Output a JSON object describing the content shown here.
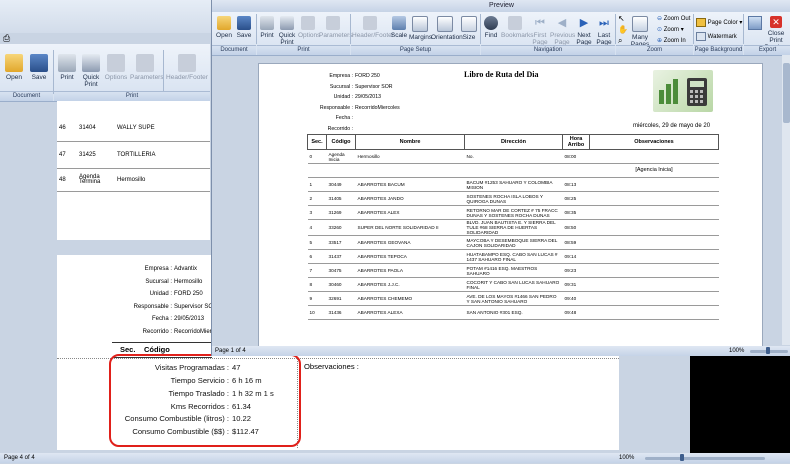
{
  "back_window": {
    "ribbon": {
      "buttons": {
        "open": "Open",
        "save": "Save",
        "print": "Print",
        "quick_print": "Quick Print",
        "options": "Options",
        "parameters": "Parameters",
        "header_footer": "Header/Footer"
      },
      "groups": {
        "document": "Document",
        "print": "Print"
      }
    },
    "upper_rows": [
      {
        "num": "46",
        "code": "31404",
        "name": "WALLY SUPE"
      },
      {
        "num": "47",
        "code": "31425",
        "name": "TORTILLERIA"
      },
      {
        "num": "48",
        "code": "Agenda Termina",
        "name": "Hermosillo"
      }
    ],
    "header": {
      "labels": {
        "empresa": "Empresa :",
        "sucursal": "Sucursal :",
        "unidad": "Unidad :",
        "responsable": "Responsable :",
        "fecha": "Fecha :",
        "recorrido": "Recorrido :"
      },
      "values": {
        "empresa": "Advantix",
        "sucursal": "Hermosillo",
        "unidad": "FORD 250",
        "responsable": "Supervisor SOR",
        "fecha": "29/05/2013",
        "recorrido": "RecorridoMiercol"
      }
    },
    "columns": {
      "sec": "Sec.",
      "codigo": "Código"
    },
    "summary": {
      "visitas_label": "Visitas Programadas :",
      "visitas_value": "47",
      "tiempo_servicio_label": "Tiempo Servicio :",
      "tiempo_servicio_value": "6 h 16 m",
      "tiempo_traslado_label": "Tiempo Traslado :",
      "tiempo_traslado_value": "1 h 32 m 1 s",
      "kms_label": "Kms Recorridos :",
      "kms_value": "61.34",
      "consumo_litros_label": "Consumo Combustible (litros) :",
      "consumo_litros_value": "10.22",
      "consumo_pesos_label": "Consumo Combustible ($$) :",
      "consumo_pesos_value": "$112.47",
      "observaciones_label": "Observaciones :"
    },
    "status": {
      "page": "Page 4 of 4",
      "zoom": "100%"
    },
    "highlight_color": "#e0201a"
  },
  "preview_window": {
    "title": "Preview",
    "ribbon": {
      "buttons": {
        "open": "Open",
        "save": "Save",
        "print": "Print",
        "quick_print": "Quick Print",
        "options": "Options",
        "parameters": "Parameters",
        "header_footer": "Header/Footer",
        "scale": "Scale",
        "margins": "Margins",
        "orientation": "Orientation",
        "size": "Size",
        "find": "Find",
        "bookmarks": "Bookmarks",
        "first_page": "First Page",
        "previous_page": "Previous Page",
        "next_page": "Next Page",
        "last_page": "Last Page",
        "many_pages": "Many Pages",
        "zoom_out": "Zoom Out",
        "zoom": "Zoom",
        "zoom_in": "Zoom In",
        "page_color": "Page Color",
        "watermark": "Watermark",
        "close": "Close Print Preview"
      },
      "groups": {
        "document": "Document",
        "print": "Print",
        "page_setup": "Page Setup",
        "navigation": "Navigation",
        "zoom": "Zoom",
        "page_background": "Page Background",
        "export": "Export"
      }
    },
    "report": {
      "title": "Libro de Ruta del Dia",
      "labels": {
        "empresa": "Empresa :",
        "sucursal": "Sucursal :",
        "unidad": "Unidad :",
        "responsable": "Responsable :",
        "fecha": "Fecha :",
        "recorrido": "Recorrido :"
      },
      "values": {
        "empresa": "",
        "sucursal": "",
        "unidad": "FORD 250",
        "responsable": "Supervisor SOR",
        "fecha": "29/05/2013",
        "recorrido": "RecorridoMiercoles"
      },
      "date_long": "miércoles, 29 de mayo de 20",
      "columns": {
        "sec": "Sec.",
        "codigo": "Código",
        "nombre": "Nombre",
        "direccion": "Dirección",
        "hora": "Hora Arribo",
        "observaciones": "Observaciones"
      },
      "rows": [
        {
          "sec": "0",
          "codigo": "Agenda Inicia",
          "nombre": "Hermosillo",
          "direccion": "No.",
          "hora": "08:00",
          "obs": ""
        },
        {
          "sec": "",
          "codigo": "",
          "nombre": "",
          "direccion": "",
          "hora": "",
          "obs": "[Agencia Inicia]"
        },
        {
          "sec": "1",
          "codigo": "30449",
          "nombre": "ABARROTES BACUM",
          "direccion": "BACUM #1253 SAHUARO Y COLOMBIA MISION",
          "hora": "08:13",
          "obs": ""
        },
        {
          "sec": "2",
          "codigo": "31405",
          "nombre": "ABARROTES JANDO",
          "direccion": "SOSTENES ROCHA ISLA LOBOS Y QUIROGA DUNAS",
          "hora": "08:25",
          "obs": ""
        },
        {
          "sec": "3",
          "codigo": "31269",
          "nombre": "ABARROTES ALEX",
          "direccion": "RETORNO MAR DE CORTEZ # 75 FRACC DUNAS Y SOSTENES ROCHA DUNAS",
          "hora": "08:35",
          "obs": ""
        },
        {
          "sec": "4",
          "codigo": "33260",
          "nombre": "SUPER DEL NORTE SOLIDARIDAD II",
          "direccion": "BLVD. JUAN BAUTISTA E. Y SIERRA DEL TULE #68 SIERRA DE HUERTAS SOLIDARIDAD",
          "hora": "08:50",
          "obs": ""
        },
        {
          "sec": "5",
          "codigo": "33517",
          "nombre": "ABARROTES GEOVANA",
          "direccion": "MAYCOBA Y DESEMBOQUE SIERRA DEL CAJON SOLIDARIDAD",
          "hora": "08:59",
          "obs": ""
        },
        {
          "sec": "6",
          "codigo": "31437",
          "nombre": "ABARROTES TEPOCA",
          "direccion": "HUATABAMPO ESQ. CABO SAN LUCAS # 1437 SAHUARO FINAL",
          "hora": "09:14",
          "obs": ""
        },
        {
          "sec": "7",
          "codigo": "30475",
          "nombre": "ABARROTES PAOLA",
          "direccion": "POTAM #1416 ESQ. MAESTROS SAHUARO",
          "hora": "09:23",
          "obs": ""
        },
        {
          "sec": "8",
          "codigo": "30460",
          "nombre": "ABARROTES J.J.C.",
          "direccion": "COCORIT Y CABO SAN LUCAS SAHUARO FINAL",
          "hora": "09:31",
          "obs": ""
        },
        {
          "sec": "9",
          "codigo": "32691",
          "nombre": "ABARROTES CHEMEMO",
          "direccion": "AVE. DE LOS MAYOS #1466 SAN PEDRO Y SAN ANTONIO SAHUARO",
          "hora": "09:40",
          "obs": ""
        },
        {
          "sec": "10",
          "codigo": "31436",
          "nombre": "ABARROTES ALEXA",
          "direccion": "SAN ANTONIO #301 ESQ.",
          "hora": "09:48",
          "obs": ""
        }
      ]
    },
    "status": {
      "page": "Page 1 of 4",
      "zoom": "100%"
    }
  }
}
